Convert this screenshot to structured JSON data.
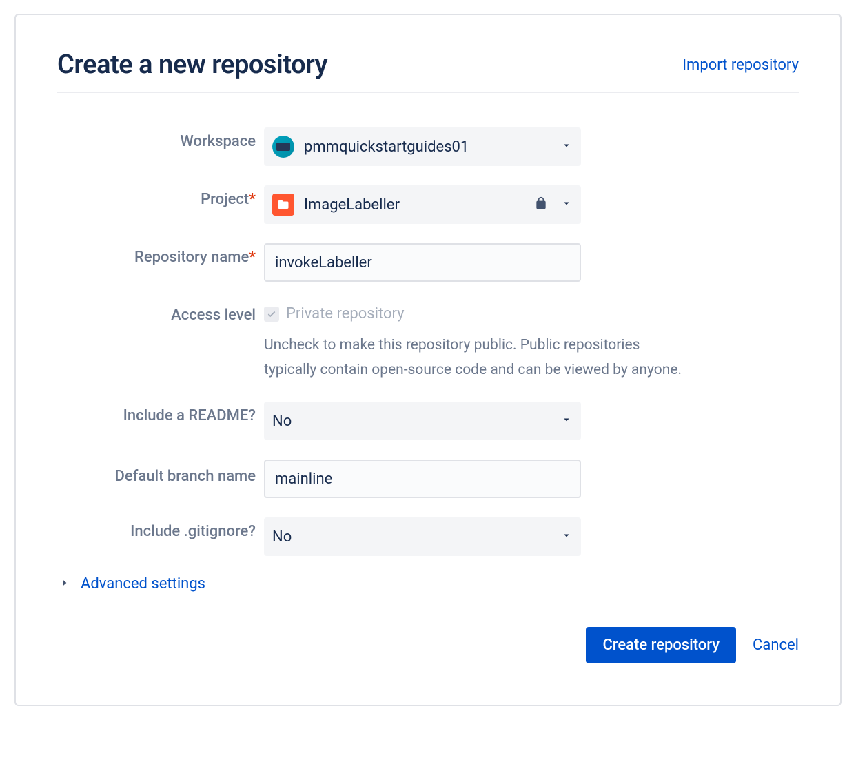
{
  "header": {
    "title": "Create a new repository",
    "import_link": "Import repository"
  },
  "form": {
    "workspace_label": "Workspace",
    "workspace_value": "pmmquickstartguides01",
    "project_label": "Project",
    "project_value": "ImageLabeller",
    "repo_name_label": "Repository name",
    "repo_name_value": "invokeLabeller",
    "access_level_label": "Access level",
    "access_checkbox_label": "Private repository",
    "access_help": "Uncheck to make this repository public. Public repositories typically contain open-source code and can be viewed by anyone.",
    "readme_label": "Include a README?",
    "readme_value": "No",
    "default_branch_label": "Default branch name",
    "default_branch_value": "mainline",
    "gitignore_label": "Include .gitignore?",
    "gitignore_value": "No",
    "advanced_label": "Advanced settings"
  },
  "buttons": {
    "create": "Create repository",
    "cancel": "Cancel"
  }
}
